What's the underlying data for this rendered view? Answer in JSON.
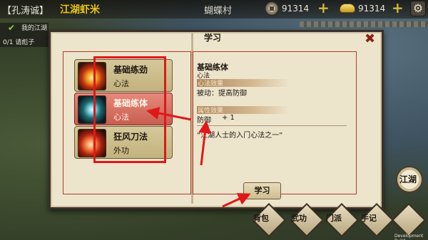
{
  "topbar": {
    "player_name": "【孔涛诚】",
    "player_title": "江湖虾米",
    "location": "蝴蝶村",
    "coins": "91314",
    "ingots": "91314",
    "coin_icon": "copper-coin-icon",
    "ingot_icon": "gold-ingot-icon",
    "add_symbol": "+",
    "settings_icon": "⚙"
  },
  "quest": {
    "check": "✔",
    "title": "我的江湖",
    "progress": "0/1 请彪子"
  },
  "dialog": {
    "title": "学习",
    "close_label": "✖",
    "learn_button": "学习"
  },
  "skills": [
    {
      "name": "基础练劲",
      "type": "心法",
      "icon": "fire-fist-icon"
    },
    {
      "name": "基础练体",
      "type": "心法",
      "icon": "aura-body-icon",
      "selected": true
    },
    {
      "name": "狂风刀法",
      "type": "外功",
      "icon": "wind-blade-icon"
    }
  ],
  "detail": {
    "name": "基础练体",
    "category": "心法",
    "effect_label": "心法效果",
    "effect_text": "被动：提高防御",
    "attr_label": "属性效果",
    "attr_name": "防御",
    "attr_value": "+ 1",
    "quote": "“江湖人士的入门心法之一”"
  },
  "menu": {
    "jianghu": "江湖",
    "items": [
      "背包",
      "武功",
      "门派",
      "手记"
    ]
  },
  "dev_build": "Development Build",
  "colors": {
    "accent_red": "#e01818",
    "title_yellow": "#e6c21c",
    "parchment": "#ede4cc"
  }
}
